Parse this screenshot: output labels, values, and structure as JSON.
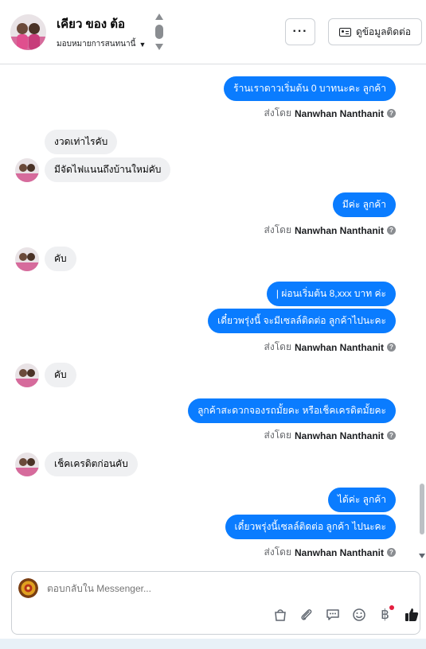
{
  "header": {
    "name": "เคียว ของ ต้อ",
    "assign_label": "มอบหมายการสนทนานี้",
    "more_label": "···",
    "contact_label": "ดูข้อมูลติดต่อ"
  },
  "messages": {
    "m1": "ร้านเราดาวเริ่มต้น 0 บาทนะคะ  ลูกค้า",
    "m2": "งวดเท่าไรคับ",
    "m3": "มีจัดไฟแนนถึงบ้านใหม่คับ",
    "m4": "มีค่ะ  ลูกค้า",
    "m5": "คับ",
    "m6": "| ผ่อนเริ่มต้น 8,xxx บาท ค่ะ",
    "m7": "เดี๋ยวพรุ่งนี้ จะมีเซลล์ติดต่อ ลูกค้าไปนะคะ",
    "m8": "คับ",
    "m9": "ลูกค้าสะดวกจองรถมั้ยคะ  หรือเช็คเครดิตมั้ยคะ",
    "m10": "เช็คเครดิตก่อนคับ",
    "m11": "ได้ค่ะ  ลูกค้า",
    "m12": "เดี๋ยวพรุ่งนี้เซลล์ติดต่อ ลูกค้า ไปนะคะ"
  },
  "sent_by": {
    "prefix": "ส่งโดย",
    "agent": "Nanwhan Nanthanit",
    "help": "?"
  },
  "composer": {
    "placeholder": "ตอบกลับใน Messenger..."
  },
  "icons": [
    "shop-icon",
    "attach-icon",
    "saved-replies-icon",
    "emoji-icon",
    "baht-payment-icon",
    "like-icon"
  ],
  "colors": {
    "outgoing_bubble": "#0a7cff",
    "incoming_bubble": "#eff0f2",
    "notification_dot": "#e41e3f"
  }
}
